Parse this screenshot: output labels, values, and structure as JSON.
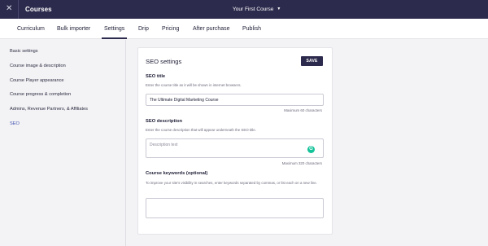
{
  "topbar": {
    "close_icon": "close-icon",
    "close_glyph": "✕",
    "title": "Courses",
    "course_select": "Your First Course",
    "caret_glyph": "▼"
  },
  "tabs": [
    {
      "label": "Curriculum"
    },
    {
      "label": "Bulk importer"
    },
    {
      "label": "Settings",
      "active": true
    },
    {
      "label": "Drip"
    },
    {
      "label": "Pricing"
    },
    {
      "label": "After purchase"
    },
    {
      "label": "Publish"
    }
  ],
  "sidebar": {
    "items": [
      {
        "label": "Basic settings"
      },
      {
        "label": "Course image & description"
      },
      {
        "label": "Course Player appearance"
      },
      {
        "label": "Course progress & completion"
      },
      {
        "label": "Admins, Revenue Partners, & Affiliates"
      },
      {
        "label": "SEO",
        "active": true
      }
    ]
  },
  "seo": {
    "title": "SEO settings",
    "save_label": "SAVE",
    "seo_title": {
      "label": "SEO title",
      "help": "Enter the course title as it will be shown in internet browsers.",
      "value": "The Ultimate Digital Marketing Course",
      "counter": "Maximum 60 characters"
    },
    "seo_description": {
      "label": "SEO description",
      "help": "Enter the course description that will appear underneath the SEO title.",
      "placeholder": "Description text",
      "counter": "Maximum 320 characters",
      "grammarly_glyph": "G"
    },
    "keywords": {
      "label": "Course keywords (optional)",
      "help": "To improve your site's visibility in searches, enter keywords separated by commas, or list each on a new line."
    }
  },
  "colors": {
    "topbar": "#2d2b4d",
    "accent_link": "#3d4fb0",
    "grammarly": "#15c39a"
  }
}
